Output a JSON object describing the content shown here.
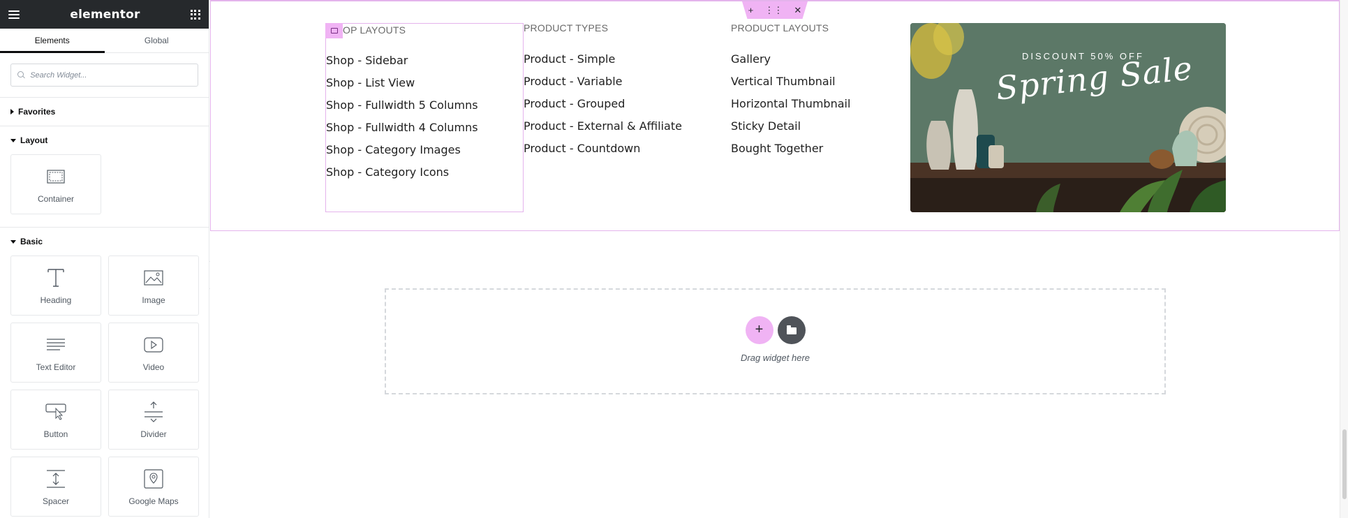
{
  "panel": {
    "logo": "elementor",
    "tabs": [
      "Elements",
      "Global"
    ],
    "search_placeholder": "Search Widget...",
    "categories": {
      "favorites": "Favorites",
      "layout": "Layout",
      "basic": "Basic"
    },
    "layout_widgets": [
      "Container"
    ],
    "basic_widgets": [
      "Heading",
      "Image",
      "Text Editor",
      "Video",
      "Button",
      "Divider",
      "Spacer",
      "Google Maps"
    ]
  },
  "canvas": {
    "columns": [
      {
        "title": "OP LAYOUTS",
        "items": [
          "Shop - Sidebar",
          "Shop - List View",
          "Shop - Fullwidth 5 Columns",
          "Shop - Fullwidth 4 Columns",
          "Shop - Category Images",
          "Shop - Category Icons"
        ]
      },
      {
        "title": "PRODUCT TYPES",
        "items": [
          "Product - Simple",
          "Product - Variable",
          "Product - Grouped",
          "Product - External & Affiliate",
          "Product - Countdown"
        ]
      },
      {
        "title": "PRODUCT LAYOUTS",
        "items": [
          "Gallery",
          "Vertical Thumbnail",
          "Horizontal Thumbnail",
          "Sticky Detail",
          "Bought Together"
        ]
      }
    ],
    "banner": {
      "caption_top": "DISCOUNT 50% OFF",
      "caption_script": "Spring Sale"
    },
    "dropzone_text": "Drag widget here"
  },
  "colors": {
    "panel_header_bg": "#26292c",
    "accent_pink": "#f0b3f4",
    "selection_outline": "#e4b3ec"
  }
}
